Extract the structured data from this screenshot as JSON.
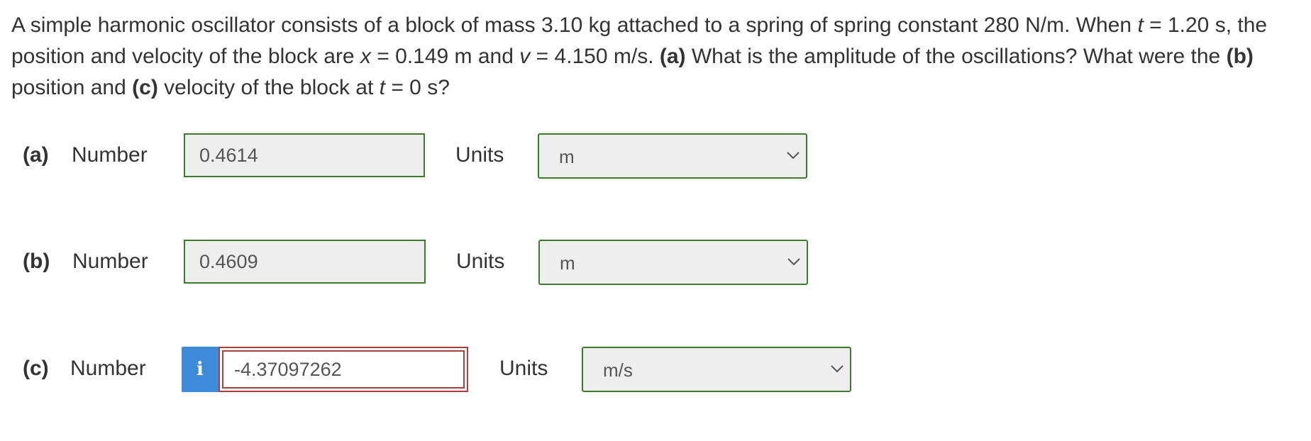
{
  "question": {
    "s1": "A simple harmonic oscillator consists of a block of mass 3.10 kg attached to a spring of spring constant 280 N/m. When ",
    "t1": "t",
    "s2": " = 1.20 s, the position and velocity of the block are ",
    "x": "x",
    "s3": " = 0.149 m and ",
    "v": "v",
    "s4": " = 4.150 m/s. ",
    "a": "(a)",
    "s5": " What is the amplitude of the oscillations? What were the ",
    "b": "(b)",
    "s6": " position and ",
    "c": "(c)",
    "s7": " velocity of the block at ",
    "t2": "t",
    "s8": " = 0 s?"
  },
  "rows": [
    {
      "part": "(a)",
      "number_label": "Number",
      "value": "0.4614",
      "units_label": "Units",
      "unit": "m"
    },
    {
      "part": "(b)",
      "number_label": "Number",
      "value": "0.4609",
      "units_label": "Units",
      "unit": "m"
    },
    {
      "part": "(c)",
      "number_label": "Number",
      "value": "-4.37097262",
      "units_label": "Units",
      "unit": "m/s",
      "info_icon": "i"
    }
  ],
  "colors": {
    "correct_border": "#3d7a2e",
    "error_border": "#a8413b",
    "info_button": "#3d8ad9"
  }
}
